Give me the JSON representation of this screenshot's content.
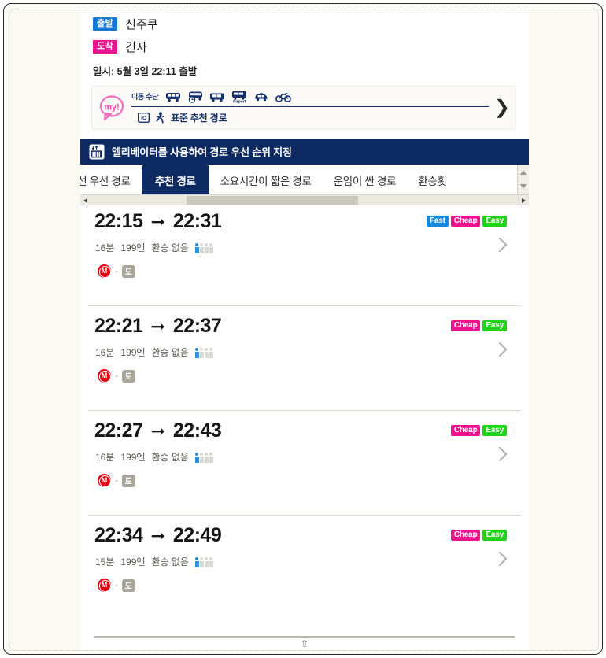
{
  "journey": {
    "departure_chip": "출발",
    "departure_station": "신주쿠",
    "arrival_chip": "도착",
    "arrival_station": "긴자",
    "datetime_line": "일시: 5월 3일 22:11 출발"
  },
  "conditions": {
    "my_badge_text": "my!",
    "mode_label": "이동 수단",
    "modes": [
      {
        "name": "train-icon",
        "label": "전철"
      },
      {
        "name": "express-train-icon",
        "label": "특급"
      },
      {
        "name": "bus-icon",
        "label": "버스"
      },
      {
        "name": "airport-bus-icon",
        "label": "Airport"
      },
      {
        "name": "taxi-icon",
        "label": "택시"
      },
      {
        "name": "bicycle-icon",
        "label": "자전거"
      }
    ],
    "ic_icon_text": "IC",
    "preference_text": "표준 추천 경로",
    "expand_chevron": "❯"
  },
  "elevator_banner": {
    "icon": "elevator-icon",
    "text": "엘리베이터를 사용하여 경로 우선 순위 지정"
  },
  "tabs": {
    "items": [
      {
        "label": "트로선 우선 경로",
        "active": false
      },
      {
        "label": "추천 경로",
        "active": true
      },
      {
        "label": "소요시간이 짧은 경로",
        "active": false
      },
      {
        "label": "운임이 싼 경로",
        "active": false
      },
      {
        "label": "환승횟",
        "active": false
      }
    ]
  },
  "routes": [
    {
      "depart": "22:15",
      "arrow": "➞",
      "arrive": "22:31",
      "badges": [
        "Fast",
        "Cheap",
        "Easy"
      ],
      "duration": "16분",
      "fare": "199엔",
      "transfers": "환승 없음",
      "crowding_filled": 1,
      "crowding_total": 4,
      "lines": [
        {
          "type": "metro",
          "label": "M"
        },
        {
          "type": "separator",
          "label": "-"
        },
        {
          "type": "walk",
          "label": "도"
        }
      ]
    },
    {
      "depart": "22:21",
      "arrow": "➞",
      "arrive": "22:37",
      "badges": [
        "Cheap",
        "Easy"
      ],
      "duration": "16분",
      "fare": "199엔",
      "transfers": "환승 없음",
      "crowding_filled": 1,
      "crowding_total": 4,
      "lines": [
        {
          "type": "metro",
          "label": "M"
        },
        {
          "type": "separator",
          "label": "-"
        },
        {
          "type": "walk",
          "label": "도"
        }
      ]
    },
    {
      "depart": "22:27",
      "arrow": "➞",
      "arrive": "22:43",
      "badges": [
        "Cheap",
        "Easy"
      ],
      "duration": "16분",
      "fare": "199엔",
      "transfers": "환승 없음",
      "crowding_filled": 1,
      "crowding_total": 4,
      "lines": [
        {
          "type": "metro",
          "label": "M"
        },
        {
          "type": "separator",
          "label": "-"
        },
        {
          "type": "walk",
          "label": "도"
        }
      ]
    },
    {
      "depart": "22:34",
      "arrow": "➞",
      "arrive": "22:49",
      "badges": [
        "Cheap",
        "Easy"
      ],
      "duration": "15분",
      "fare": "199엔",
      "transfers": "환승 없음",
      "crowding_filled": 1,
      "crowding_total": 4,
      "lines": [
        {
          "type": "metro",
          "label": "M"
        },
        {
          "type": "separator",
          "label": "-"
        },
        {
          "type": "walk",
          "label": "도"
        }
      ]
    }
  ],
  "footer": {
    "scroll_top_glyph": "⇧"
  },
  "colors": {
    "navy": "#0e2a63",
    "departure_blue": "#1478d2",
    "arrival_magenta": "#e3158f",
    "fast_blue": "#1788e0",
    "cheap_pink": "#f0118f",
    "easy_green": "#1ed318",
    "metro_red": "#e60012",
    "page_bg": "#faf9f4"
  }
}
